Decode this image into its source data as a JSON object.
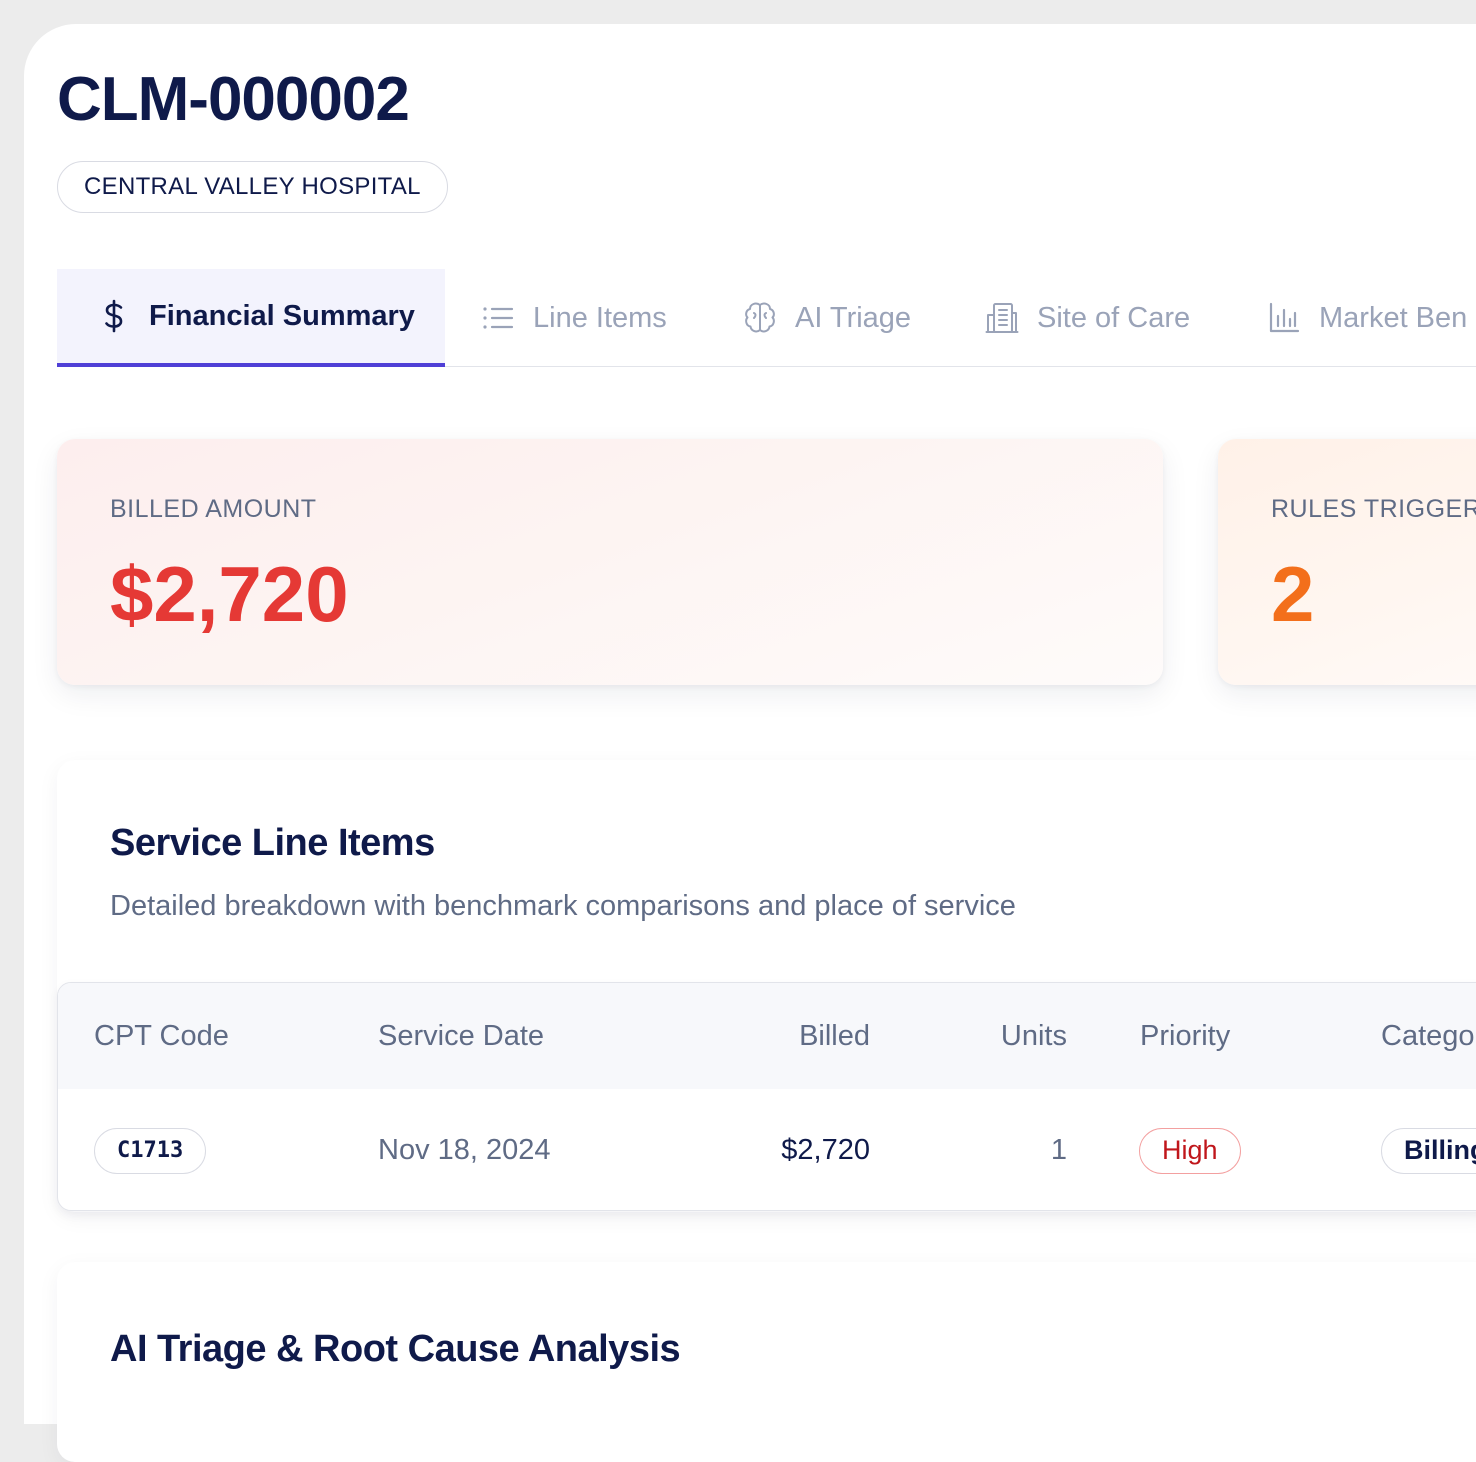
{
  "claim": {
    "id": "CLM-000002",
    "provider": "CENTRAL VALLEY HOSPITAL"
  },
  "tabs": [
    {
      "label": "Financial Summary",
      "icon": "dollar-icon",
      "active": true
    },
    {
      "label": "Line Items",
      "icon": "list-icon",
      "active": false
    },
    {
      "label": "AI Triage",
      "icon": "brain-icon",
      "active": false
    },
    {
      "label": "Site of Care",
      "icon": "building-icon",
      "active": false
    },
    {
      "label": "Market Ben",
      "icon": "bar-chart-icon",
      "active": false
    }
  ],
  "metrics": {
    "billed": {
      "label": "BILLED AMOUNT",
      "value": "$2,720",
      "color": "#e53935"
    },
    "rules": {
      "label": "RULES TRIGGERE",
      "value": "2",
      "color": "#f36f1b"
    }
  },
  "line_items": {
    "title": "Service Line Items",
    "subtitle": "Detailed breakdown with benchmark comparisons and place of service",
    "columns": [
      "CPT Code",
      "Service Date",
      "Billed",
      "Units",
      "Priority",
      "Catego"
    ],
    "rows": [
      {
        "cpt_code": "C1713",
        "service_date": "Nov 18, 2024",
        "billed": "$2,720",
        "units": "1",
        "priority": "High",
        "category": "Billing"
      }
    ]
  },
  "triage": {
    "title": "AI Triage & Root Cause Analysis"
  },
  "colors": {
    "accent": "#4f3fd6",
    "navy": "#0f1a4a",
    "muted": "#5f6b85",
    "danger": "#e53935",
    "warning": "#f36f1b"
  }
}
